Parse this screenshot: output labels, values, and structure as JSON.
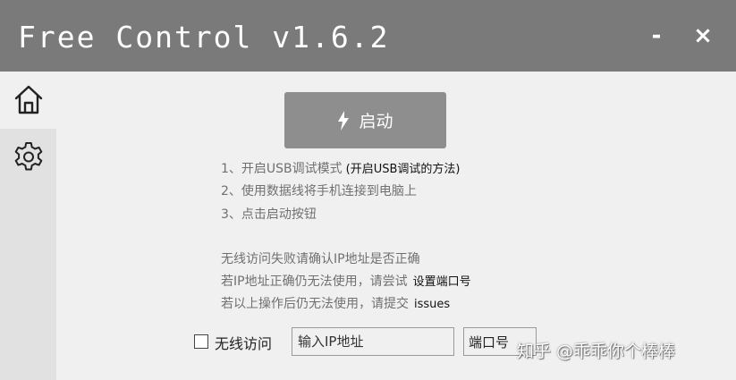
{
  "window": {
    "title": "Free Control v1.6.2",
    "minimize_glyph": "-",
    "close_glyph": "×"
  },
  "sidebar": {
    "items": [
      {
        "name": "home",
        "icon": "home-icon"
      },
      {
        "name": "settings",
        "icon": "gear-icon"
      }
    ]
  },
  "main": {
    "start_button": {
      "label": "启动",
      "icon": "lightning-icon"
    },
    "steps": [
      "1、开启USB调试模式",
      "2、使用数据线将手机连接到电脑上",
      "3、点击启动按钮"
    ],
    "step1_link": "(开启USB调试的方法)",
    "wireless_help": {
      "line1": "无线访问失败请确认IP地址是否正确",
      "line2": "若IP地址正确仍无法使用，请尝试",
      "line2_link": "设置端口号",
      "line3": "若以上操作后仍无法使用，请提交",
      "line3_link": "issues"
    },
    "wireless": {
      "checkbox_label": "无线访问",
      "checked": false,
      "ip_placeholder": "输入IP地址",
      "ip_value": "",
      "port_button": "端口号"
    }
  },
  "watermark": "知乎 @乖乖你个棒棒",
  "colors": {
    "titlebar": "#7a7a7a",
    "sidebar": "#e1e1e1",
    "background": "#f0f0f0",
    "start_button": "#8e8e8e",
    "help_text": "#707070"
  }
}
